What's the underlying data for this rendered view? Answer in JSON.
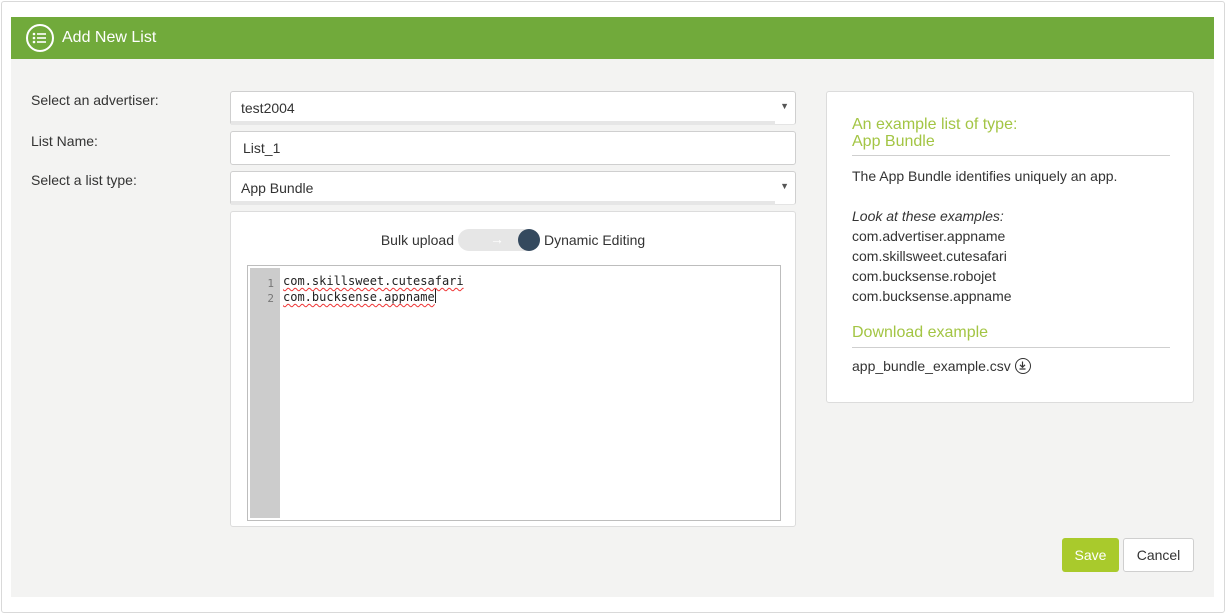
{
  "header": {
    "title": "Add New List",
    "icon": "list-icon"
  },
  "form": {
    "advertiser_label": "Select an advertiser:",
    "advertiser_value": "test2004",
    "list_name_label": "List Name:",
    "list_name_value": "List_1",
    "list_type_label": "Select a list type:",
    "list_type_value": "App Bundle"
  },
  "editor": {
    "toggle_left_label": "Bulk upload",
    "toggle_right_label": "Dynamic Editing",
    "toggle_arrow": "→",
    "toggle_state": "Dynamic Editing",
    "lines": [
      {
        "no": "1",
        "text": "com.skillsweet.cutesafari"
      },
      {
        "no": "2",
        "text": "com.bucksense.appname"
      }
    ]
  },
  "example": {
    "title_line1": "An example list of type:",
    "title_line2": "App Bundle",
    "description": "The App Bundle identifies uniquely an app.",
    "examples_heading": "Look at these examples:",
    "examples": [
      "com.advertiser.appname",
      "com.skillsweet.cutesafari",
      "com.bucksense.robojet",
      "com.bucksense.appname"
    ],
    "download_heading": "Download example",
    "download_file": "app_bundle_example.csv",
    "download_icon": "download-icon"
  },
  "actions": {
    "save_label": "Save",
    "cancel_label": "Cancel"
  },
  "colors": {
    "header": "#71aa3b",
    "accent": "#a3c544",
    "save": "#a9ca2c",
    "toggle_knob": "#34495e"
  }
}
